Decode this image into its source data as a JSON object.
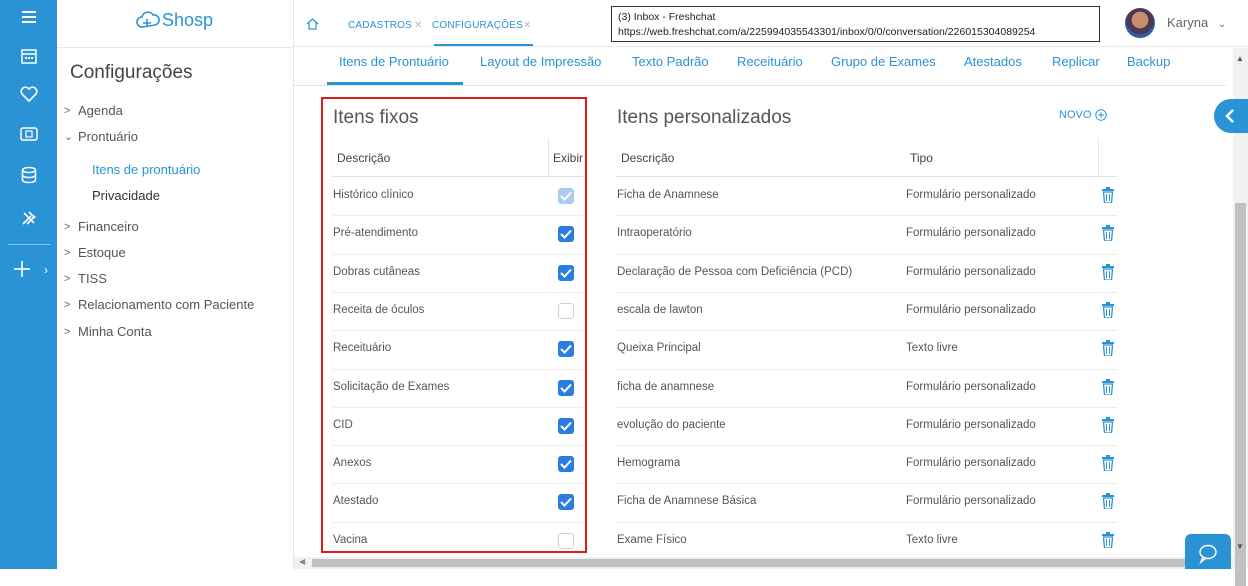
{
  "app": {
    "logo_text": "Shosp",
    "brand_color": "#2a93d5",
    "accent_checkbox": "#2a7de1",
    "highlight_border": "#e01b1b"
  },
  "rail": {
    "icons": [
      "menu-icon",
      "calendar-icon",
      "heart-icon",
      "money-icon",
      "database-icon",
      "tools-icon",
      "plus-icon"
    ]
  },
  "sidebar": {
    "title": "Configurações",
    "items": [
      {
        "label": "Agenda",
        "expanded": false
      },
      {
        "label": "Prontuário",
        "expanded": true
      },
      {
        "label": "Financeiro",
        "expanded": false
      },
      {
        "label": "Estoque",
        "expanded": false
      },
      {
        "label": "TISS",
        "expanded": false
      },
      {
        "label": "Relacionamento com Paciente",
        "expanded": false
      },
      {
        "label": "Minha Conta",
        "expanded": false
      }
    ],
    "subitems": [
      {
        "label": "Itens de prontuário",
        "active": true
      },
      {
        "label": "Privacidade",
        "active": false
      }
    ]
  },
  "topbar": {
    "breadcrumb": [
      {
        "label": "CADASTROS"
      },
      {
        "label": "CONFIGURAÇÕES"
      }
    ],
    "tooltip_title": "(3) Inbox - Freshchat",
    "tooltip_url": "https://web.freshchat.com/a/225994035543301/inbox/0/0/conversation/226015304089254",
    "user_name": "Karyna"
  },
  "tabs": [
    "Itens de Prontuário",
    "Layout de Impressão",
    "Texto Padrão",
    "Receituário",
    "Grupo de Exames",
    "Atestados",
    "Replicar",
    "Backup"
  ],
  "fixed": {
    "title": "Itens fixos",
    "col_desc": "Descrição",
    "col_show": "Exibir",
    "rows": [
      {
        "label": "Histórico clínico",
        "checked": true,
        "disabled": true
      },
      {
        "label": "Pré-atendimento",
        "checked": true
      },
      {
        "label": "Dobras cutâneas",
        "checked": true
      },
      {
        "label": "Receita de óculos",
        "checked": false
      },
      {
        "label": "Receituário",
        "checked": true
      },
      {
        "label": "Solicitação de Exames",
        "checked": true
      },
      {
        "label": "CID",
        "checked": true
      },
      {
        "label": "Anexos",
        "checked": true
      },
      {
        "label": "Atestado",
        "checked": true
      },
      {
        "label": "Vacina",
        "checked": false
      }
    ]
  },
  "custom": {
    "title": "Itens personalizados",
    "new_label": "NOVO",
    "col_desc": "Descrição",
    "col_type": "Tipo",
    "rows": [
      {
        "desc": "Ficha de Anamnese",
        "type": "Formulário personalizado"
      },
      {
        "desc": "Intraoperatório",
        "type": "Formulário personalizado"
      },
      {
        "desc": "Declaração de Pessoa com Deficiência (PCD)",
        "type": "Formulário personalizado"
      },
      {
        "desc": "escala de lawton",
        "type": "Formulário personalizado"
      },
      {
        "desc": "Queixa Principal",
        "type": "Texto livre"
      },
      {
        "desc": "ficha de anamnese",
        "type": "Formulário personalizado"
      },
      {
        "desc": "evolução do paciente",
        "type": "Formulário personalizado"
      },
      {
        "desc": "Hemograma",
        "type": "Formulário personalizado"
      },
      {
        "desc": "Ficha de Anamnese Básica",
        "type": "Formulário personalizado"
      },
      {
        "desc": "Exame Físico",
        "type": "Texto livre"
      }
    ]
  }
}
